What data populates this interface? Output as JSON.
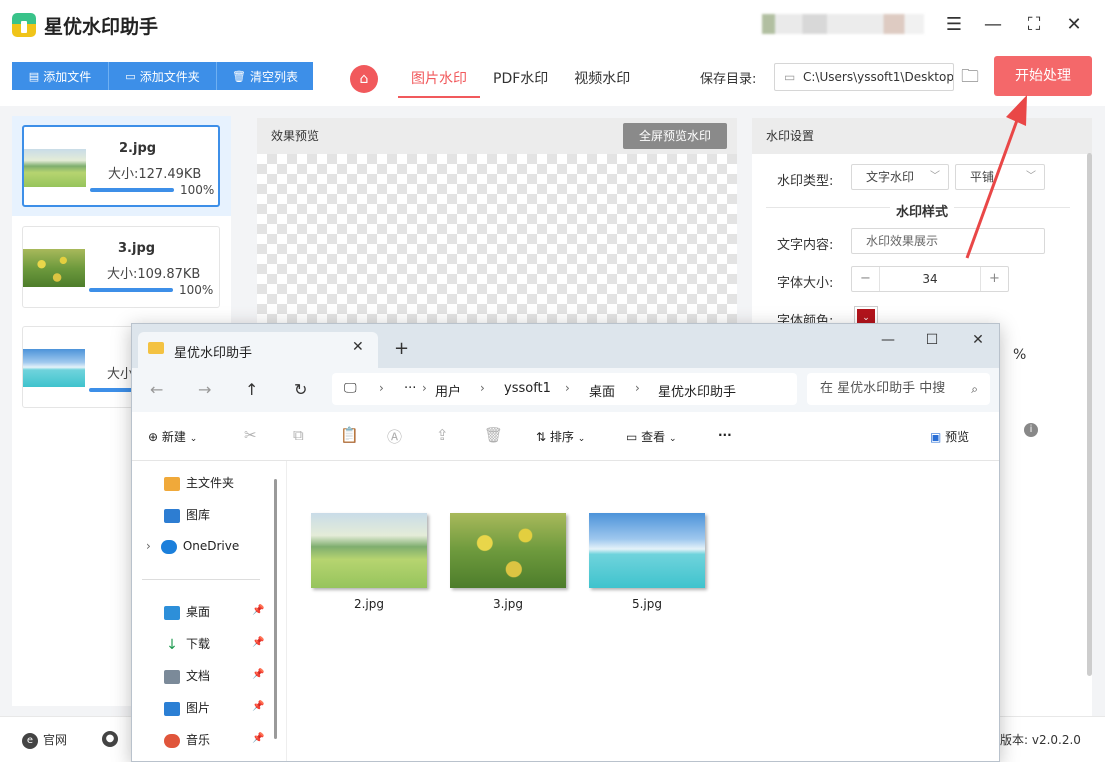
{
  "app": {
    "title": "星优水印助手"
  },
  "toolbar": {
    "add_file": "添加文件",
    "add_folder": "添加文件夹",
    "clear_list": "清空列表",
    "tabs": [
      "图片水印",
      "PDF水印",
      "视频水印"
    ],
    "active_tab": "图片水印",
    "save_dir_label": "保存目录:",
    "save_dir_path": "C:\\Users\\yssoft1\\Desktop",
    "start_button": "开始处理"
  },
  "files": [
    {
      "name": "2.jpg",
      "size": "大小:127.49KB",
      "progress": "100%"
    },
    {
      "name": "3.jpg",
      "size": "大小:109.87KB",
      "progress": "100%"
    },
    {
      "name": "",
      "size": "大小",
      "progress": ""
    }
  ],
  "preview": {
    "title": "效果预览",
    "fullscreen_button": "全屏预览水印"
  },
  "settings": {
    "title": "水印设置",
    "type_label": "水印类型:",
    "type_value": "文字水印",
    "layout_value": "平铺",
    "style_title": "水印样式",
    "text_label": "文字内容:",
    "text_placeholder": "水印效果展示",
    "font_size_label": "字体大小:",
    "font_size_value": "34",
    "font_color_label": "字体颜色:",
    "font_color": "#b3141c",
    "percent_unit": "%"
  },
  "bottom": {
    "official_site": "官网",
    "version": "版本: v2.0.2.0"
  },
  "explorer": {
    "tab_title": "星优水印助手",
    "breadcrumb": [
      "用户",
      "yssoft1",
      "桌面",
      "星优水印助手"
    ],
    "search_placeholder": "在 星优水印助手 中搜",
    "new_button": "新建",
    "sort_button": "排序",
    "view_button": "查看",
    "preview_button": "预览",
    "more": "···",
    "sidebar": [
      {
        "label": "主文件夹",
        "pinned": false
      },
      {
        "label": "图库",
        "pinned": false
      },
      {
        "label": "OneDrive",
        "pinned": false
      },
      {
        "label": "桌面",
        "pinned": true
      },
      {
        "label": "下载",
        "pinned": true
      },
      {
        "label": "文档",
        "pinned": true
      },
      {
        "label": "图片",
        "pinned": true
      },
      {
        "label": "音乐",
        "pinned": true
      }
    ],
    "files": [
      "2.jpg",
      "3.jpg",
      "5.jpg"
    ]
  },
  "colors": {
    "accent_red": "#f1595c",
    "accent_blue": "#3d8fe8"
  }
}
